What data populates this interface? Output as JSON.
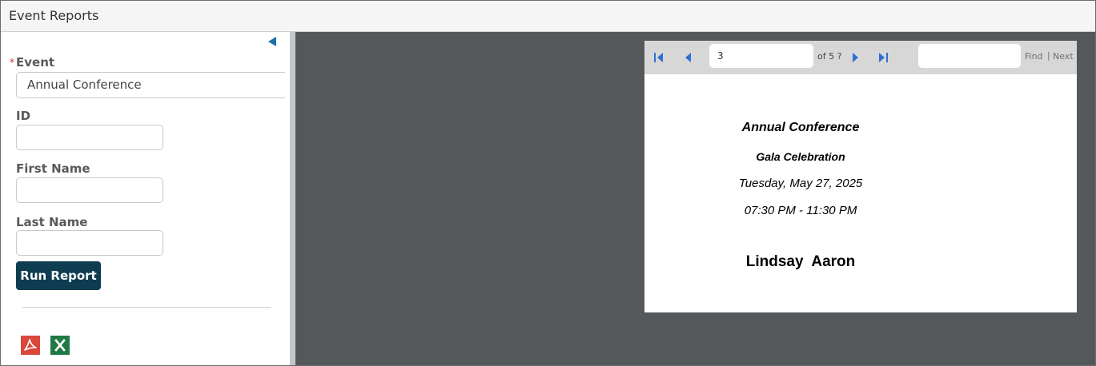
{
  "app": {
    "title": "Event Reports"
  },
  "filters": {
    "event_label": "Event",
    "event_required_marker": "*",
    "event_value": "Annual Conference",
    "id_label": "ID",
    "id_value": "",
    "first_name_label": "First Name",
    "first_name_value": "",
    "last_name_label": "Last Name",
    "last_name_value": "",
    "run_button_label": "Run Report"
  },
  "exports": {
    "pdf_icon": "pdf-icon",
    "excel_icon": "excel-icon",
    "pdf_color": "#d9483b",
    "excel_color": "#1f7a43"
  },
  "viewer": {
    "current_page": "3",
    "page_of_text": "of 5 ?",
    "find_value": "",
    "find_label": "Find",
    "find_separator": "|",
    "next_label": "Next"
  },
  "report": {
    "event_name": "Annual Conference",
    "session_name": "Gala Celebration",
    "date": "Tuesday, May 27, 2025",
    "time": "07:30 PM - 11:30 PM",
    "attendee_name": "Lindsay  Aaron"
  },
  "colors": {
    "accent": "#0e3d52",
    "nav_icon": "#1b6fa8",
    "viewer_background": "#54585b",
    "required": "#d9262b"
  }
}
